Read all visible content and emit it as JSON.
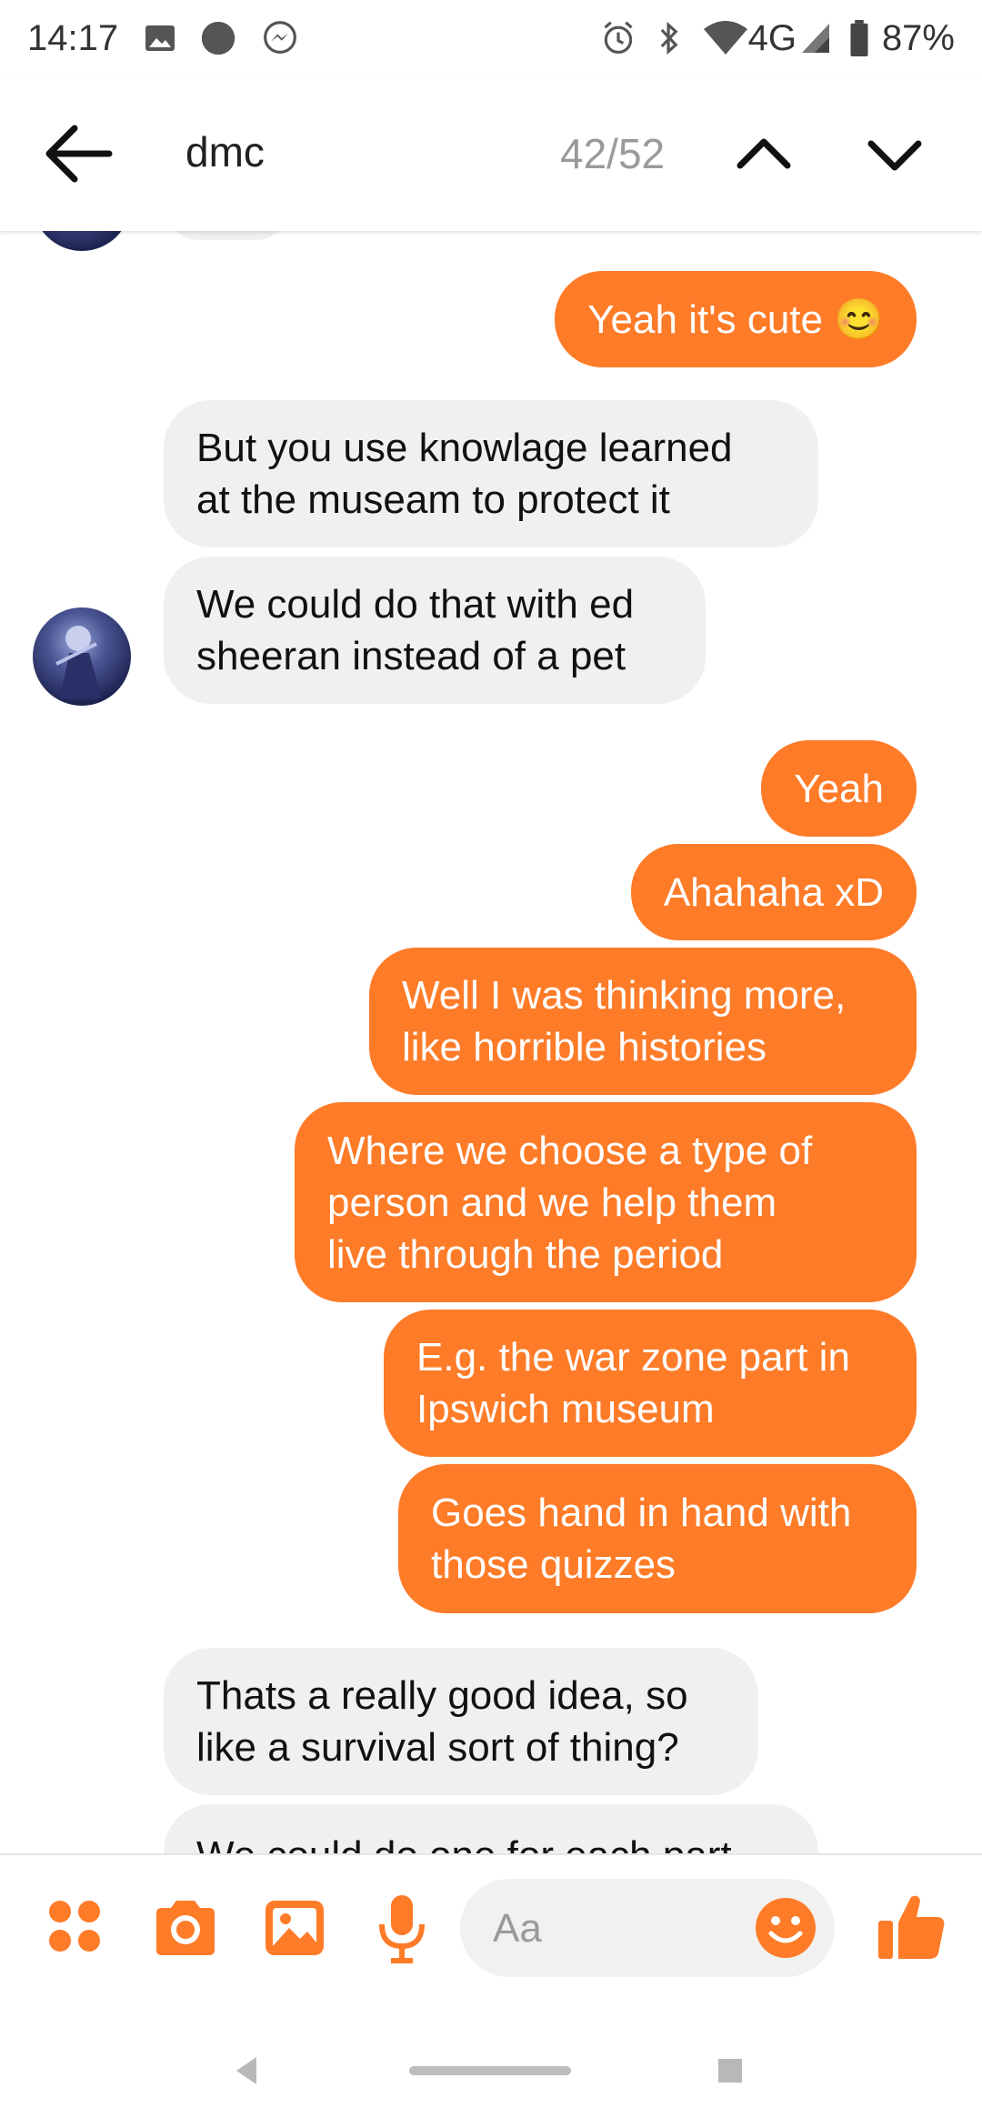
{
  "status_bar": {
    "time": "14:17",
    "network": "4G",
    "battery": "87%"
  },
  "header": {
    "search_term": "dmc",
    "match_counter": "42/52"
  },
  "messages": [
    {
      "side": "out",
      "lines": [
        "Yeah it's cute 😊"
      ]
    },
    {
      "side": "in",
      "lines": [
        "But you use knowlage learned",
        "at the museam to protect it"
      ]
    },
    {
      "side": "in",
      "lines": [
        "We could do that with ed",
        "sheeran instead of a pet"
      ]
    },
    {
      "side": "out",
      "lines": [
        "Yeah"
      ]
    },
    {
      "side": "out",
      "lines": [
        "Ahahaha xD"
      ]
    },
    {
      "side": "out",
      "lines": [
        "Well I was thinking more,",
        "like horrible histories"
      ]
    },
    {
      "side": "out",
      "lines": [
        "Where we choose a type of",
        "person and we help them",
        "live through the period"
      ]
    },
    {
      "side": "out",
      "lines": [
        "E.g. the war zone part in",
        "Ipswich museum"
      ]
    },
    {
      "side": "out",
      "lines": [
        "Goes hand in hand with",
        "those quizzes"
      ]
    },
    {
      "side": "in",
      "lines": [
        "Thats a really good idea, so",
        "like a survival sort of thing?"
      ]
    },
    {
      "side": "in",
      "lines": [
        "We could do one for each part"
      ]
    }
  ],
  "composer": {
    "placeholder": "Aa"
  },
  "icons": {
    "back": "arrow-left-icon",
    "prev": "chevron-up-icon",
    "next": "chevron-down-icon",
    "more": "four-dots-icon",
    "camera": "camera-icon",
    "gallery": "image-icon",
    "mic": "microphone-icon",
    "emoji": "smiley-icon",
    "like": "thumbs-up-icon"
  },
  "colors": {
    "accent": "#fe7b28",
    "incoming_bubble": "#f0f0f0"
  }
}
